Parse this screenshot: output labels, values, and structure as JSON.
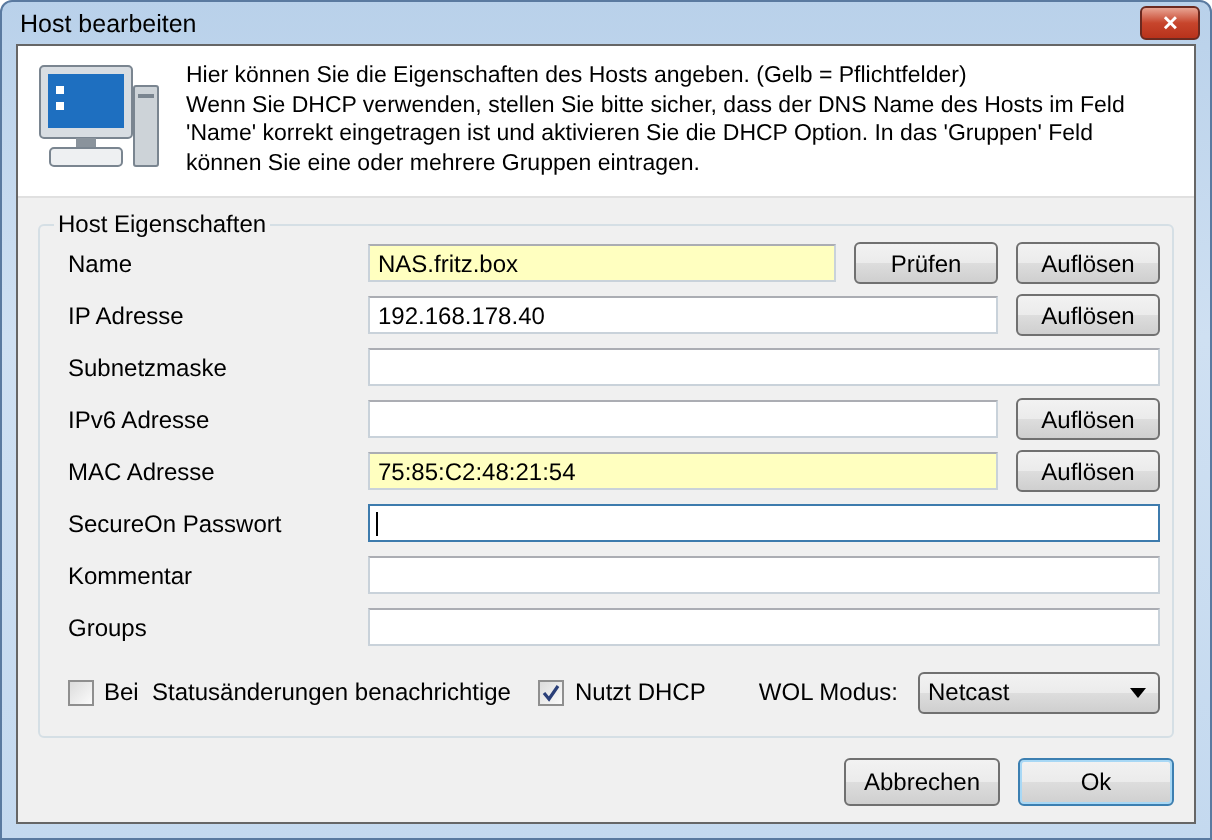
{
  "window": {
    "title": "Host bearbeiten",
    "close": "✕"
  },
  "header": {
    "lines": [
      "Hier können Sie die Eigenschaften des Hosts angeben. (Gelb = Pflichtfelder)",
      "Wenn Sie DHCP verwenden, stellen Sie bitte sicher, dass der DNS Name des Hosts im Feld 'Name' korrekt eingetragen ist und aktivieren Sie die DHCP Option. In das 'Gruppen' Feld können Sie eine oder mehrere Gruppen eintragen."
    ]
  },
  "group": {
    "title": "Host Eigenschaften",
    "fields": [
      {
        "label": "Name",
        "value": "NAS.fritz.box",
        "required": true,
        "focused": false,
        "buttons": [
          "Prüfen",
          "Auflösen"
        ]
      },
      {
        "label": "IP Adresse",
        "value": "192.168.178.40",
        "required": false,
        "focused": false,
        "buttons": [
          "Auflösen"
        ]
      },
      {
        "label": "Subnetzmaske",
        "required": false,
        "focused": false
      },
      {
        "label": "IPv6 Adresse",
        "required": false,
        "focused": false,
        "buttons": [
          "Auflösen"
        ]
      },
      {
        "label": "MAC Adresse",
        "value": "75:85:C2:48:21:54",
        "required": true,
        "focused": false,
        "buttons": [
          "Auflösen"
        ]
      },
      {
        "label": "SecureOn Passwort",
        "required": false,
        "focused": true
      },
      {
        "label": "Kommentar",
        "required": false,
        "focused": false
      },
      {
        "label": "Groups",
        "required": false,
        "focused": false
      }
    ],
    "checkboxes": [
      {
        "label": "Bei  Statusänderungen benachrichtige",
        "checked": false
      },
      {
        "label": "Nutzt DHCP",
        "checked": true
      }
    ],
    "wol": {
      "label": "WOL Modus:",
      "value": "Netcast"
    }
  },
  "buttons": [
    {
      "label": "Abbrechen",
      "default": false
    },
    {
      "label": "Ok",
      "default": true
    }
  ]
}
